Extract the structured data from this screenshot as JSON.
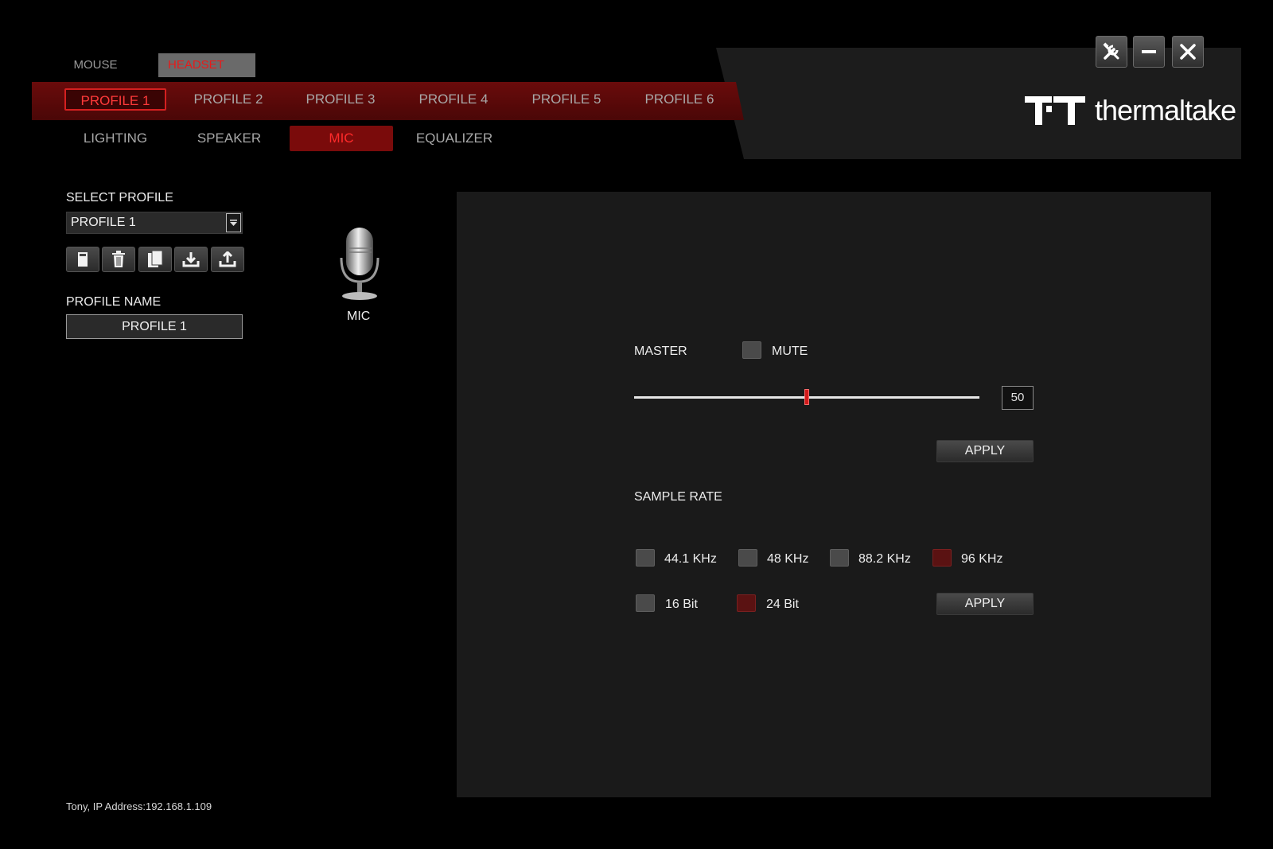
{
  "device_tabs": {
    "mouse": "MOUSE",
    "headset": "HEADSET"
  },
  "profiles": [
    "PROFILE 1",
    "PROFILE 2",
    "PROFILE 3",
    "PROFILE 4",
    "PROFILE 5",
    "PROFILE 6"
  ],
  "sub_tabs": [
    "LIGHTING",
    "SPEAKER",
    "MIC",
    "EQUALIZER"
  ],
  "brand": {
    "name": "thermaltake",
    "accent": "#d21a1a"
  },
  "window_buttons": [
    "settings-icon",
    "minimize-icon",
    "close-icon"
  ],
  "left_panel": {
    "select_profile_label": "SELECT PROFILE",
    "selected_profile": "PROFILE 1",
    "toolbar_icons": [
      "save-icon",
      "delete-icon",
      "copy-icon",
      "import-icon",
      "export-icon"
    ],
    "profile_name_label": "PROFILE NAME",
    "profile_name_value": "PROFILE 1"
  },
  "mic_icon_label": "MIC",
  "master": {
    "label": "MASTER",
    "mute_label": "MUTE",
    "mute_checked": false,
    "volume": 50,
    "volume_text": "50",
    "apply_label": "APPLY"
  },
  "sample_rate": {
    "label": "SAMPLE RATE",
    "rates": [
      {
        "label": "44.1 KHz",
        "checked": false
      },
      {
        "label": "48 KHz",
        "checked": false
      },
      {
        "label": "88.2 KHz",
        "checked": false
      },
      {
        "label": "96 KHz",
        "checked": true
      }
    ],
    "bits": [
      {
        "label": "16 Bit",
        "checked": false
      },
      {
        "label": "24 Bit",
        "checked": true
      }
    ],
    "apply_label": "APPLY"
  },
  "status": "Tony, IP Address:192.168.1.109"
}
